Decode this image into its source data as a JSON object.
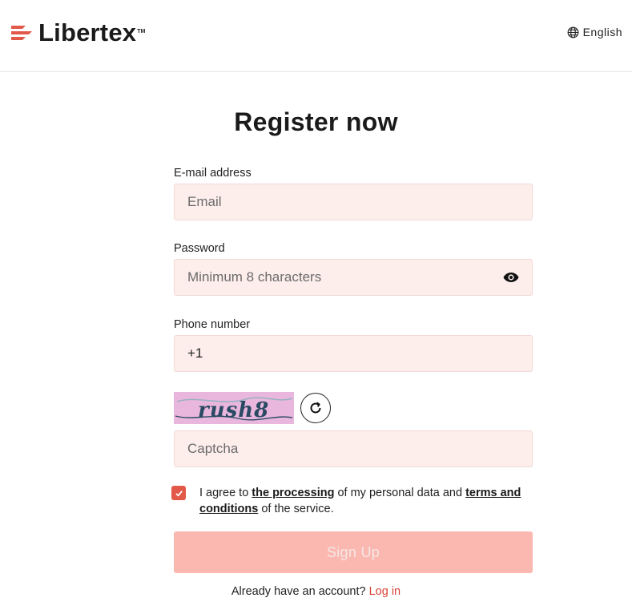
{
  "header": {
    "logo_text": "Libertex",
    "logo_tm": "TM",
    "language": "English"
  },
  "form": {
    "title": "Register now",
    "email": {
      "label": "E-mail address",
      "placeholder": "Email"
    },
    "password": {
      "label": "Password",
      "placeholder": "Minimum 8 characters"
    },
    "phone": {
      "label": "Phone number",
      "value": "+1"
    },
    "captcha": {
      "image_text": "rush8",
      "placeholder": "Captcha"
    },
    "consent": {
      "checked": true,
      "text_1": "I agree to ",
      "link_1": "the processing",
      "text_2": " of my personal data and ",
      "link_2": "terms and conditions",
      "text_3": " of the service."
    },
    "submit_label": "Sign Up",
    "login_prompt": "Already have an account?",
    "login_link": "Log in"
  },
  "colors": {
    "brand": "#e2594a",
    "field_bg": "#fdeeec",
    "button_bg": "#fbb8b1",
    "link": "#d9433a"
  },
  "icons": [
    "globe-icon",
    "eye-icon",
    "refresh-icon",
    "checkmark-icon"
  ]
}
